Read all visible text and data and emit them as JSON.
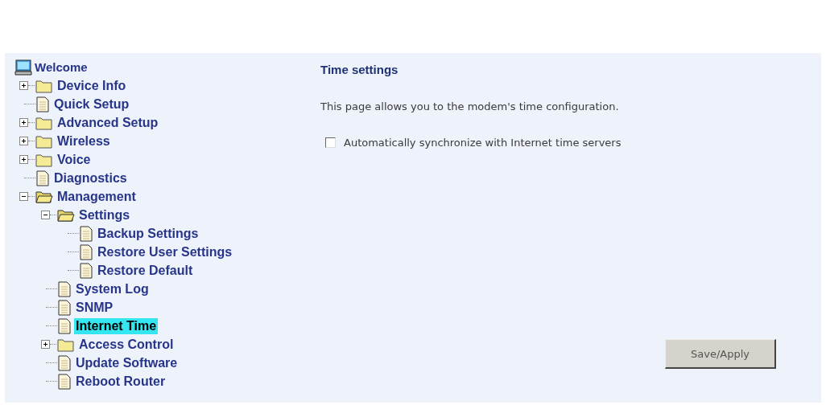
{
  "sidebar": {
    "root": {
      "label": "Welcome",
      "selected": false
    },
    "items": [
      {
        "kind": "folder",
        "label": "Device Info",
        "expanded": false,
        "selected": false
      },
      {
        "kind": "page",
        "label": "Quick Setup",
        "selected": false
      },
      {
        "kind": "folder",
        "label": "Advanced Setup",
        "expanded": false,
        "selected": false
      },
      {
        "kind": "folder",
        "label": "Wireless",
        "expanded": false,
        "selected": false
      },
      {
        "kind": "folder",
        "label": "Voice",
        "expanded": false,
        "selected": false
      },
      {
        "kind": "page",
        "label": "Diagnostics",
        "selected": false
      },
      {
        "kind": "folder",
        "label": "Management",
        "expanded": true,
        "selected": false,
        "children": [
          {
            "kind": "folder",
            "label": "Settings",
            "expanded": true,
            "selected": false,
            "children": [
              {
                "kind": "page",
                "label": "Backup Settings",
                "selected": false
              },
              {
                "kind": "page",
                "label": "Restore User Settings",
                "selected": false
              },
              {
                "kind": "page",
                "label": "Restore Default",
                "selected": false
              }
            ]
          },
          {
            "kind": "page",
            "label": "System Log",
            "selected": false
          },
          {
            "kind": "page",
            "label": "SNMP",
            "selected": false
          },
          {
            "kind": "page",
            "label": "Internet Time",
            "selected": true
          },
          {
            "kind": "folder",
            "label": "Access Control",
            "expanded": false,
            "selected": false
          },
          {
            "kind": "page",
            "label": "Update Software",
            "selected": false
          },
          {
            "kind": "page",
            "label": "Reboot Router",
            "selected": false
          }
        ]
      }
    ]
  },
  "content": {
    "title": "Time settings",
    "description": "This page allows you to the modem's time configuration.",
    "auto_sync": {
      "label": "Automatically synchronize with Internet time servers",
      "checked": false
    },
    "buttons": [
      "Save/Apply"
    ]
  }
}
